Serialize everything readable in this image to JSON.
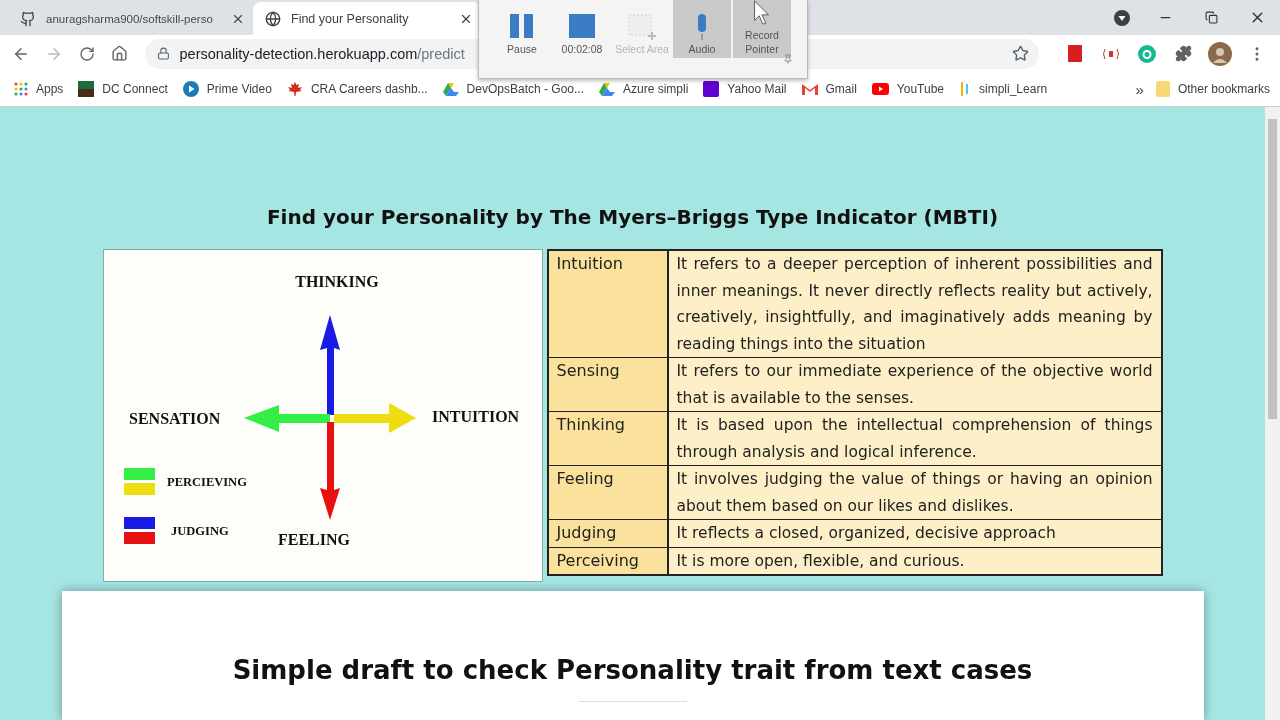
{
  "tabs": [
    {
      "title": "anuragsharma900/softskill-perso",
      "selected": false
    },
    {
      "title": "Find your Personality",
      "selected": true
    }
  ],
  "address": {
    "host": "personality-detection.herokuapp.com",
    "path": "/predict"
  },
  "bookmarks": [
    {
      "label": "Apps"
    },
    {
      "label": "DC Connect"
    },
    {
      "label": "Prime Video"
    },
    {
      "label": "CRA Careers dashb..."
    },
    {
      "label": "DevOpsBatch - Goo..."
    },
    {
      "label": "Azure simpli"
    },
    {
      "label": "Yahoo Mail"
    },
    {
      "label": "Gmail"
    },
    {
      "label": "YouTube"
    },
    {
      "label": "simpli_Learn"
    }
  ],
  "more_bookmarks": "»",
  "other_bookmarks": "Other bookmarks",
  "recorder": [
    {
      "label": "Pause",
      "kind": "pause",
      "disabled": false,
      "on": false
    },
    {
      "label": "00:02:08",
      "kind": "stop",
      "disabled": false,
      "on": false
    },
    {
      "label": "Select Area",
      "kind": "area",
      "disabled": true,
      "on": false
    },
    {
      "label": "Audio",
      "kind": "audio",
      "disabled": false,
      "on": true
    },
    {
      "label": "Record Pointer",
      "kind": "pointer",
      "disabled": false,
      "on": true
    }
  ],
  "page": {
    "title": "Find your Personality by The Myers–Briggs Type Indicator (MBTI)",
    "diagram": {
      "top": "THINKING",
      "left": "SENSATION",
      "right": "INTUITION",
      "bottom": "FEELING",
      "legend": [
        {
          "label": "PERCIEVING"
        },
        {
          "label": "JUDGING"
        }
      ]
    },
    "table": [
      {
        "term": "Intuition",
        "description": "It refers to a deeper perception of inherent possibilities and inner meanings. It never directly reflects reality but actively, creatively, insightfully, and imaginatively adds meaning by reading things into the situation"
      },
      {
        "term": "Sensing",
        "description": "It refers to our immediate experience of the objective world that is available to the senses."
      },
      {
        "term": "Thinking",
        "description": "It is based upon the intellectual comprehension of things through analysis and logical inference."
      },
      {
        "term": "Feeling",
        "description": "It involves judging the value of things or having an opinion about them based on our likes and dislikes."
      },
      {
        "term": "Judging",
        "description": "It reflects a closed, organized, decisive approach"
      },
      {
        "term": "Perceiving",
        "description": "It is more open, flexible, and curious."
      }
    ],
    "card_heading": "Simple draft to check Personality trait from text cases"
  }
}
